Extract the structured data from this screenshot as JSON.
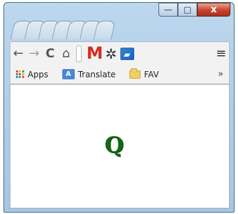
{
  "title_bar": {
    "tab_count": 7,
    "minimize_label": "—",
    "maximize_label": "□",
    "close_label": "x"
  },
  "toolbar": {
    "back": "back-icon",
    "forward": "forward-icon",
    "reload": "reload-icon",
    "home": "home-icon",
    "gmail_label": "M",
    "settings": "gear-icon",
    "image_extension": "image-icon",
    "menu": "menu-icon"
  },
  "bookmarks": {
    "items": [
      {
        "label": "Apps"
      },
      {
        "label": "Translate"
      },
      {
        "label": "FAV"
      }
    ],
    "more_label": "»"
  },
  "content": {
    "logo_text": "Q"
  },
  "colors": {
    "logo": "#0f6b10",
    "close_button": "#c9432d",
    "window_frame": "#a6c6e4"
  }
}
